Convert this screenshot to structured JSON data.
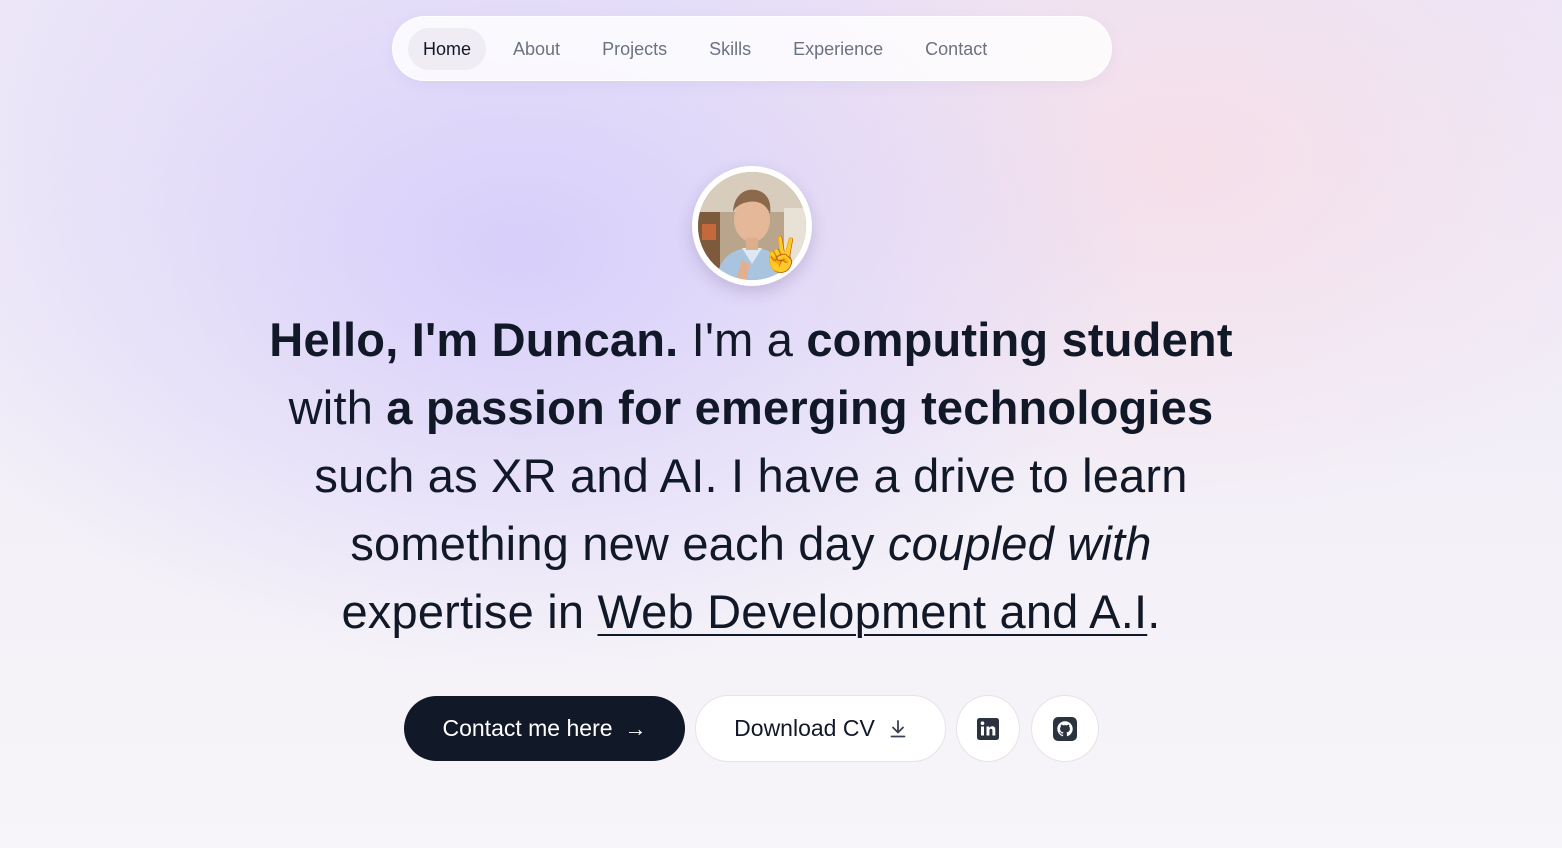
{
  "nav": {
    "items": [
      {
        "label": "Home",
        "active": true
      },
      {
        "label": "About"
      },
      {
        "label": "Projects"
      },
      {
        "label": "Skills"
      },
      {
        "label": "Experience"
      },
      {
        "label": "Contact"
      }
    ]
  },
  "avatar": {
    "emoji": "✌️"
  },
  "hero": {
    "greeting": "Hello, I'm Duncan.",
    "t1": " I'm a ",
    "role": "computing student",
    "t2": " with ",
    "passion": "a passion for emerging technologies",
    "t3": " such as XR and AI. I have a drive to learn something new each day ",
    "coupled": "coupled with",
    "t4": " expertise in ",
    "expertise": "Web Development and A.I",
    "t5": "."
  },
  "actions": {
    "contact_label": "Contact me here",
    "contact_arrow": "→",
    "cv_label": "Download CV"
  },
  "icons": {
    "linkedin": "linkedin-icon",
    "github": "github-icon",
    "download": "download-icon"
  },
  "colors": {
    "primary_dark": "#111827",
    "muted_text": "#6b7280",
    "nav_active_bg": "#efedf3"
  }
}
